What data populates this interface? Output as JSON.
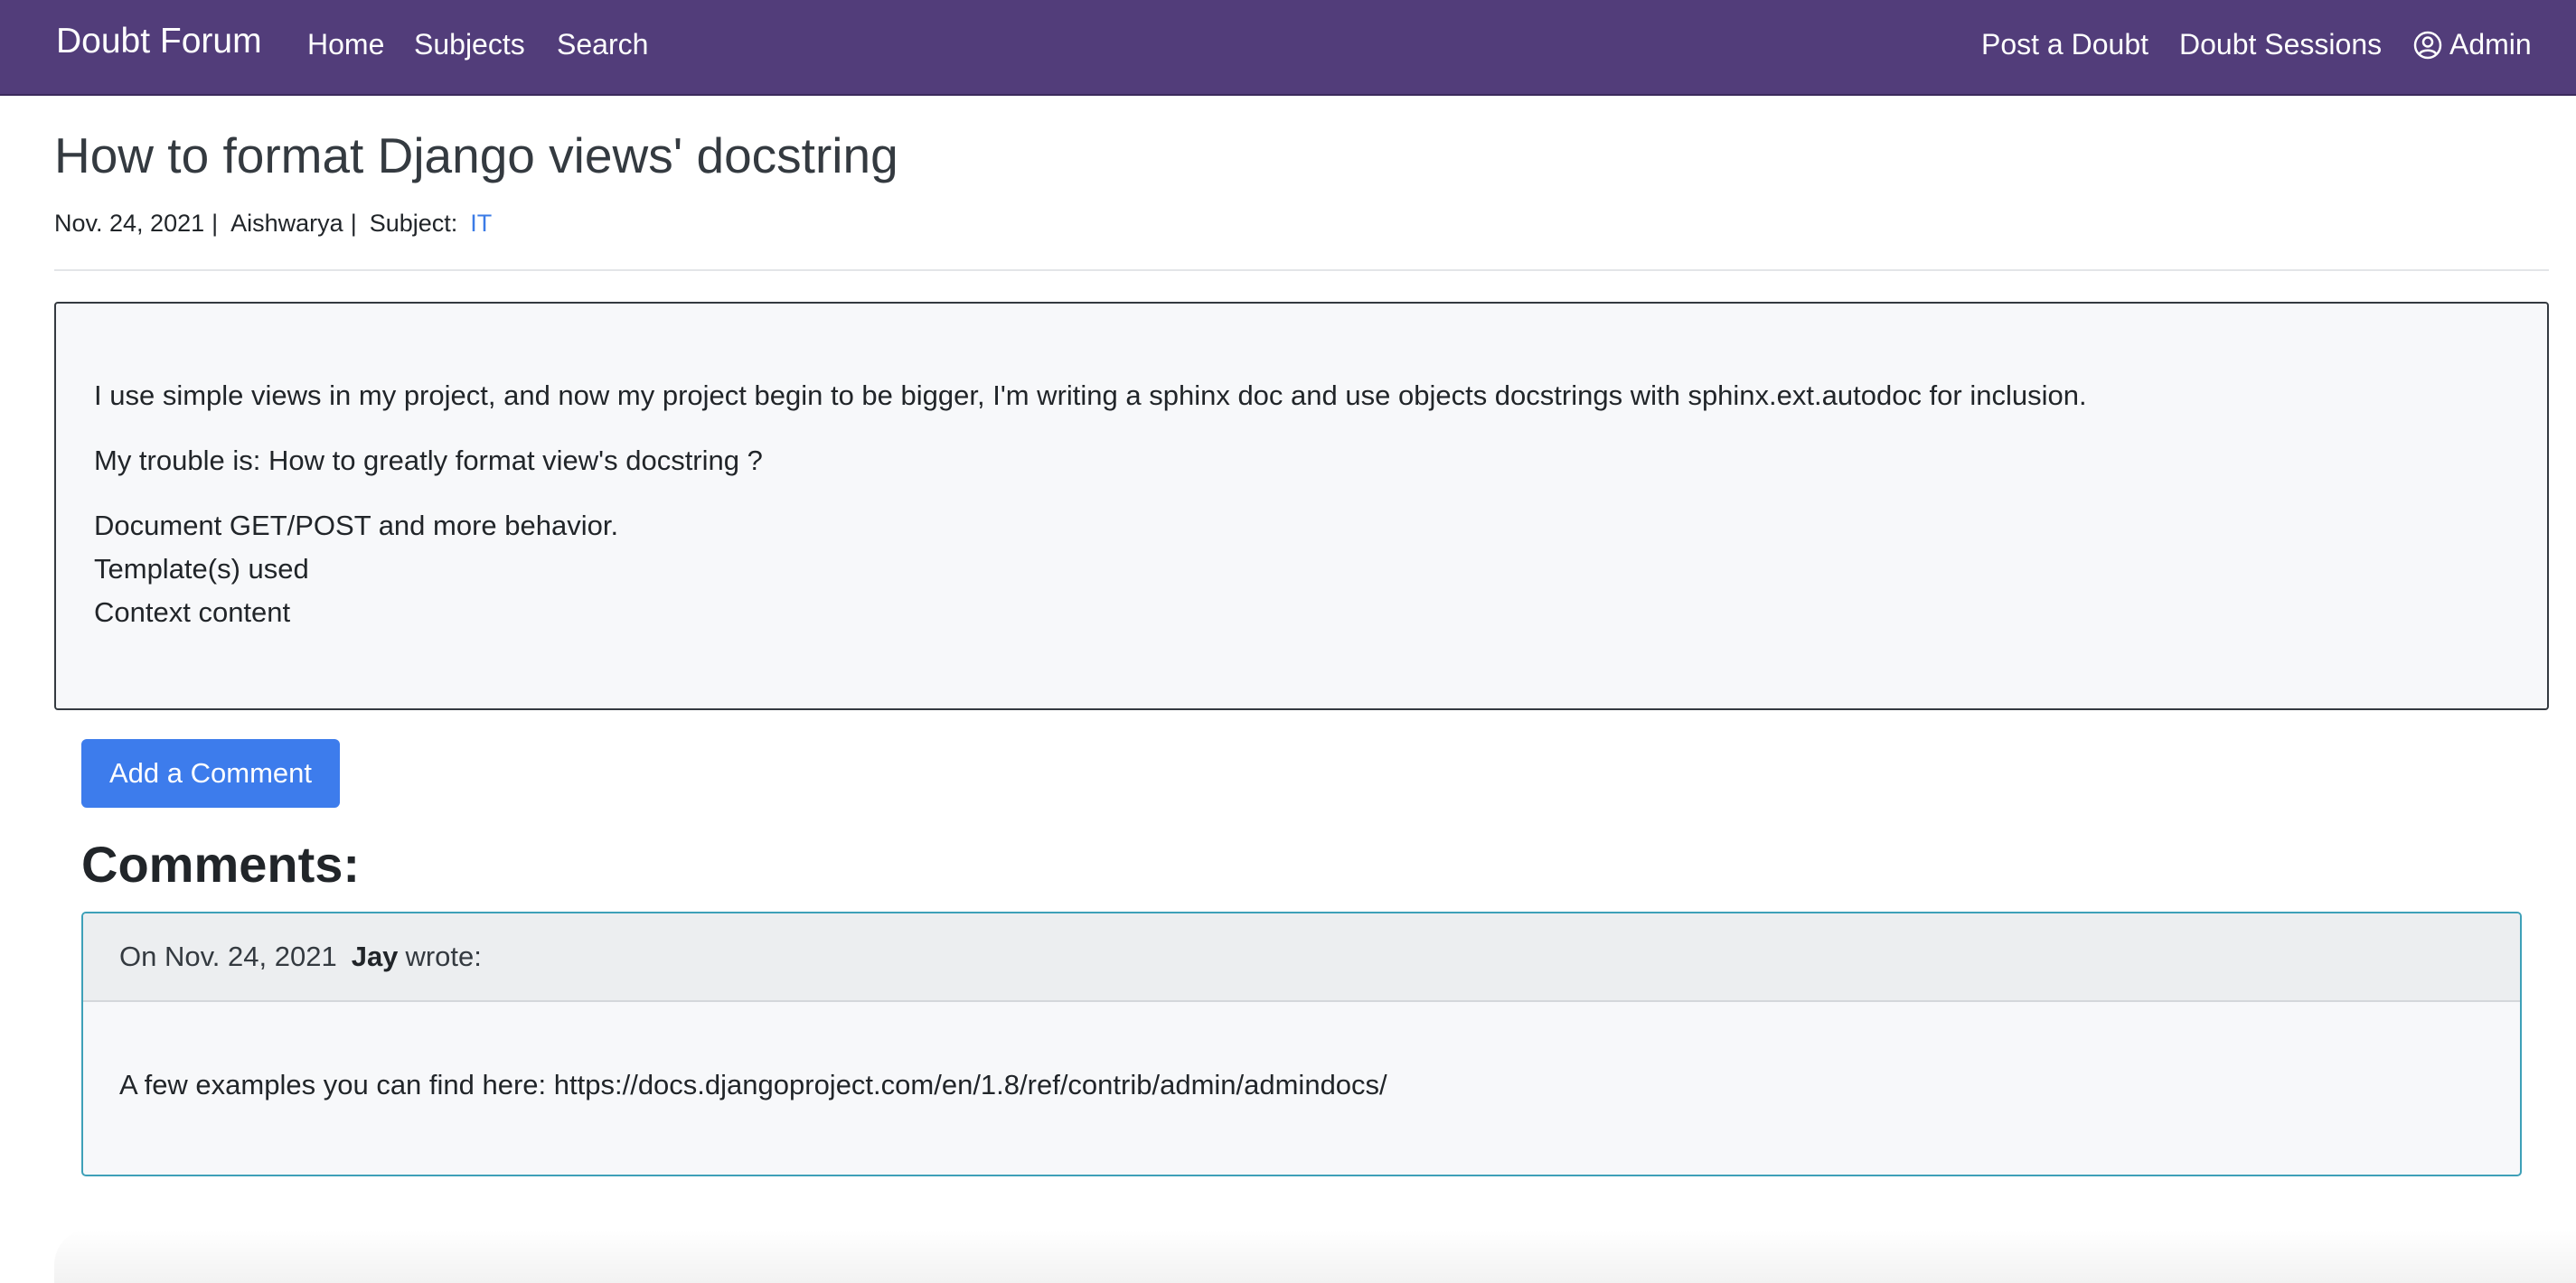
{
  "navbar": {
    "brand": "Doubt Forum",
    "left_links": [
      "Home",
      "Subjects",
      "Search"
    ],
    "right_links": [
      "Post a Doubt",
      "Doubt Sessions"
    ],
    "user_label": "Admin",
    "user_icon": "user-circle-icon",
    "background_color": "#523d7a"
  },
  "question": {
    "title": "How to format Django views' docstring",
    "date": "Nov. 24, 2021",
    "author": "Aishwarya",
    "subject_label": "Subject:",
    "subject": "IT",
    "paragraphs": [
      "I use simple views in my project, and now my project begin to be bigger, I'm writing a sphinx doc and use objects docstrings with sphinx.ext.autodoc for inclusion.",
      "My trouble is: How to greatly format view's docstring ?"
    ],
    "lines": [
      "Document GET/POST and more behavior.",
      "Template(s) used",
      "Context content"
    ]
  },
  "actions": {
    "add_comment_label": "Add a Comment",
    "button_color": "#3d7cec"
  },
  "comments": {
    "heading": "Comments:",
    "items": [
      {
        "prefix": "On Nov. 24, 2021",
        "author": "Jay",
        "suffix": "wrote:",
        "body": "A few examples you can find here: https://docs.djangoproject.com/en/1.8/ref/contrib/admin/admindocs/"
      }
    ]
  }
}
